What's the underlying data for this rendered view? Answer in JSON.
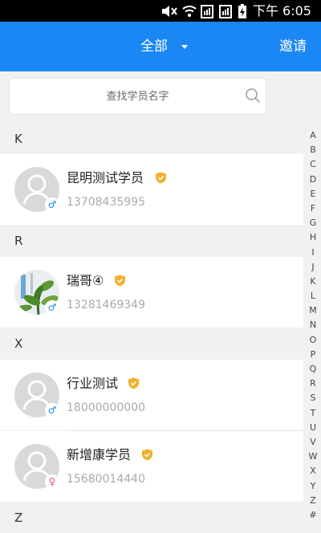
{
  "status_bar": {
    "time": "下午 6:05"
  },
  "header": {
    "title": "全部",
    "invite_label": "邀请"
  },
  "search": {
    "placeholder": "查找学员名字"
  },
  "sections": [
    {
      "letter": "K",
      "contacts": [
        {
          "name": "昆明测试学员",
          "phone": "13708435995",
          "gender": "♂"
        }
      ]
    },
    {
      "letter": "R",
      "contacts": [
        {
          "name": "瑞哥④",
          "phone": "13281469349",
          "gender": "♂"
        }
      ]
    },
    {
      "letter": "X",
      "contacts": [
        {
          "name": "行业测试",
          "phone": "18000000000",
          "gender": "♂"
        },
        {
          "name": "新增康学员",
          "phone": "15680014440",
          "gender": "♀"
        }
      ]
    },
    {
      "letter": "Z",
      "contacts": []
    }
  ],
  "index_letters": [
    "A",
    "B",
    "C",
    "D",
    "E",
    "F",
    "G",
    "H",
    "I",
    "J",
    "K",
    "L",
    "M",
    "N",
    "O",
    "P",
    "Q",
    "R",
    "S",
    "T",
    "U",
    "V",
    "W",
    "X",
    "Y",
    "Z",
    "#"
  ],
  "colors": {
    "primary": "#1b87f5",
    "badge": "#f0b12e",
    "male": "#1b87f5",
    "female": "#ec4b6e"
  },
  "icons": {
    "status": [
      "mute-icon",
      "wifi-icon",
      "sim1-signal-icon",
      "sim2-signal-icon",
      "battery-charging-icon"
    ],
    "search": "search-icon",
    "badge": "verified-shield-icon"
  }
}
